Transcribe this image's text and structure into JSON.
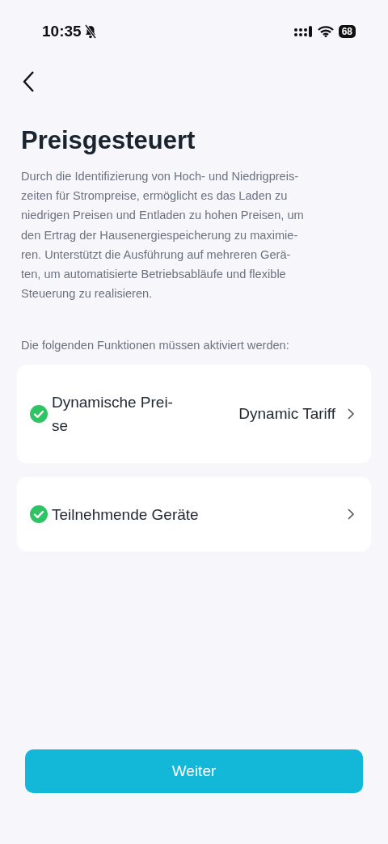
{
  "status_bar": {
    "time": "10:35",
    "silent": true,
    "battery": "68"
  },
  "title": "Preisgesteuert",
  "description": "Durch die Identifizierung von Hoch- und Niedrigpreis-\nzeiten für Strompreise, ermöglicht es das Laden zu\nniedrigen Preisen und Entladen zu hohen Preisen, um\nden Ertrag der Hausenergiespeicherung zu maximie-\nren. Unterstützt die Ausführung auf mehreren Gerä-\nten, um automatisierte Betriebsabläufe und flexible\nSteuerung zu realisieren.",
  "prompt": "Die folgenden Funktionen müssen aktiviert werden:",
  "requirements": [
    {
      "label": "Dynamische Prei-\nse",
      "value": "Dynamic Tariff",
      "checked": true
    },
    {
      "label": "Teilnehmende Geräte",
      "checked": true
    }
  ],
  "button": "Weiter"
}
